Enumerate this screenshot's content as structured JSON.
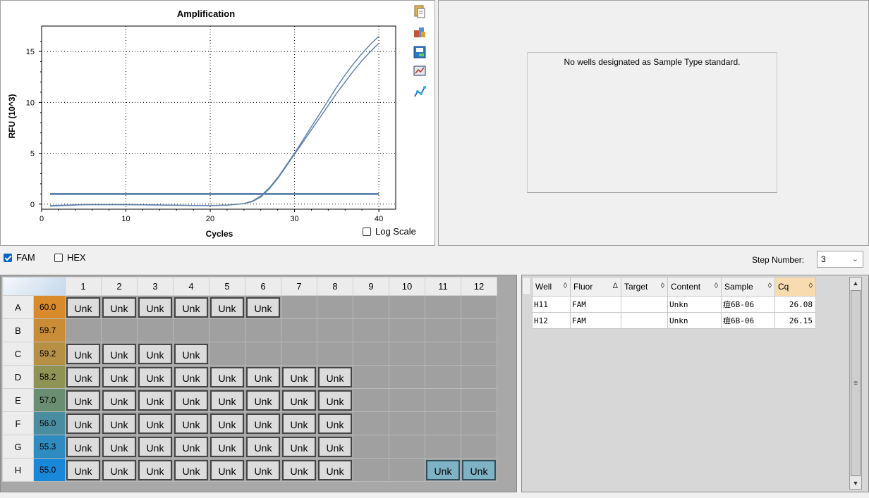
{
  "chart_data": {
    "type": "line",
    "title": "Amplification",
    "xlabel": "Cycles",
    "ylabel": "RFU (10^3)",
    "xlim": [
      0,
      42
    ],
    "ylim": [
      -0.5,
      17.5
    ],
    "xticks": [
      0,
      10,
      20,
      30,
      40
    ],
    "yticks": [
      0,
      5,
      10,
      15
    ],
    "grid": true,
    "threshold": 1.0,
    "series": [
      {
        "x": [
          1,
          5,
          10,
          15,
          20,
          22,
          24,
          25,
          26,
          27,
          28,
          29,
          30,
          31,
          32,
          33,
          34,
          35,
          36,
          37,
          38,
          39,
          40
        ],
        "y": [
          -0.15,
          -0.05,
          -0.05,
          -0.1,
          -0.15,
          -0.1,
          0.05,
          0.3,
          0.8,
          1.6,
          2.6,
          3.8,
          5.0,
          6.3,
          7.6,
          8.9,
          10.2,
          11.5,
          12.7,
          13.8,
          14.8,
          15.7,
          16.5
        ],
        "color": "#5a7fa8"
      },
      {
        "x": [
          1,
          5,
          10,
          15,
          20,
          22,
          24,
          25,
          26,
          27,
          28,
          29,
          30,
          31,
          32,
          33,
          34,
          35,
          36,
          37,
          38,
          39,
          40
        ],
        "y": [
          -0.2,
          -0.05,
          -0.05,
          -0.1,
          -0.15,
          -0.1,
          0.05,
          0.25,
          0.7,
          1.5,
          2.5,
          3.7,
          4.9,
          6.1,
          7.3,
          8.5,
          9.7,
          10.9,
          12.0,
          13.1,
          14.1,
          15.0,
          15.8
        ],
        "color": "#5a7fa8"
      }
    ]
  },
  "chart_panel": {
    "log_scale_label": "Log Scale",
    "log_scale_checked": false,
    "tools": [
      "copy-icon",
      "export-icon",
      "save-image-icon",
      "print-chart-icon",
      "chart-style-icon"
    ]
  },
  "standard_curve": {
    "message": "No wells designated as Sample Type standard."
  },
  "fluor_bar": {
    "fam_label": "FAM",
    "fam_checked": true,
    "hex_label": "HEX",
    "hex_checked": false,
    "step_label": "Step Number:",
    "step_value": "3"
  },
  "plate": {
    "columns": [
      "1",
      "2",
      "3",
      "4",
      "5",
      "6",
      "7",
      "8",
      "9",
      "10",
      "11",
      "12"
    ],
    "rows": [
      {
        "label": "A",
        "temp": "60.0",
        "temp_color": "#d98a2a",
        "wells": [
          "Unk",
          "Unk",
          "Unk",
          "Unk",
          "Unk",
          "Unk",
          "",
          "",
          "",
          "",
          "",
          ""
        ]
      },
      {
        "label": "B",
        "temp": "59.7",
        "temp_color": "#c98d38",
        "wells": [
          "",
          "",
          "",
          "",
          "",
          "",
          "",
          "",
          "",
          "",
          "",
          ""
        ]
      },
      {
        "label": "C",
        "temp": "59.2",
        "temp_color": "#b69145",
        "wells": [
          "Unk",
          "Unk",
          "Unk",
          "Unk",
          "",
          "",
          "",
          "",
          "",
          "",
          "",
          ""
        ]
      },
      {
        "label": "D",
        "temp": "58.2",
        "temp_color": "#8f9456",
        "wells": [
          "Unk",
          "Unk",
          "Unk",
          "Unk",
          "Unk",
          "Unk",
          "Unk",
          "Unk",
          "",
          "",
          "",
          ""
        ]
      },
      {
        "label": "E",
        "temp": "57.0",
        "temp_color": "#6a8e72",
        "wells": [
          "Unk",
          "Unk",
          "Unk",
          "Unk",
          "Unk",
          "Unk",
          "Unk",
          "Unk",
          "",
          "",
          "",
          ""
        ]
      },
      {
        "label": "F",
        "temp": "56.0",
        "temp_color": "#4a8da0",
        "wells": [
          "Unk",
          "Unk",
          "Unk",
          "Unk",
          "Unk",
          "Unk",
          "Unk",
          "Unk",
          "",
          "",
          "",
          ""
        ]
      },
      {
        "label": "G",
        "temp": "55.3",
        "temp_color": "#2e8cc0",
        "wells": [
          "Unk",
          "Unk",
          "Unk",
          "Unk",
          "Unk",
          "Unk",
          "Unk",
          "Unk",
          "",
          "",
          "",
          ""
        ]
      },
      {
        "label": "H",
        "temp": "55.0",
        "temp_color": "#1a88d8",
        "wells": [
          "Unk",
          "Unk",
          "Unk",
          "Unk",
          "Unk",
          "Unk",
          "Unk",
          "Unk",
          "",
          "",
          "Unk",
          "Unk"
        ]
      }
    ],
    "selected": [
      "H11",
      "H12"
    ]
  },
  "results": {
    "headers": [
      "Well",
      "Fluor",
      "Target",
      "Content",
      "Sample",
      "Cq"
    ],
    "sort_glyphs": [
      "◊",
      "Δ",
      "◊",
      "◊",
      "◊",
      "◊"
    ],
    "rows": [
      [
        "H11",
        "FAM",
        "",
        "Unkn",
        "痘6B-06",
        "26.08"
      ],
      [
        "H12",
        "FAM",
        "",
        "Unkn",
        "痘6B-06",
        "26.15"
      ]
    ]
  }
}
